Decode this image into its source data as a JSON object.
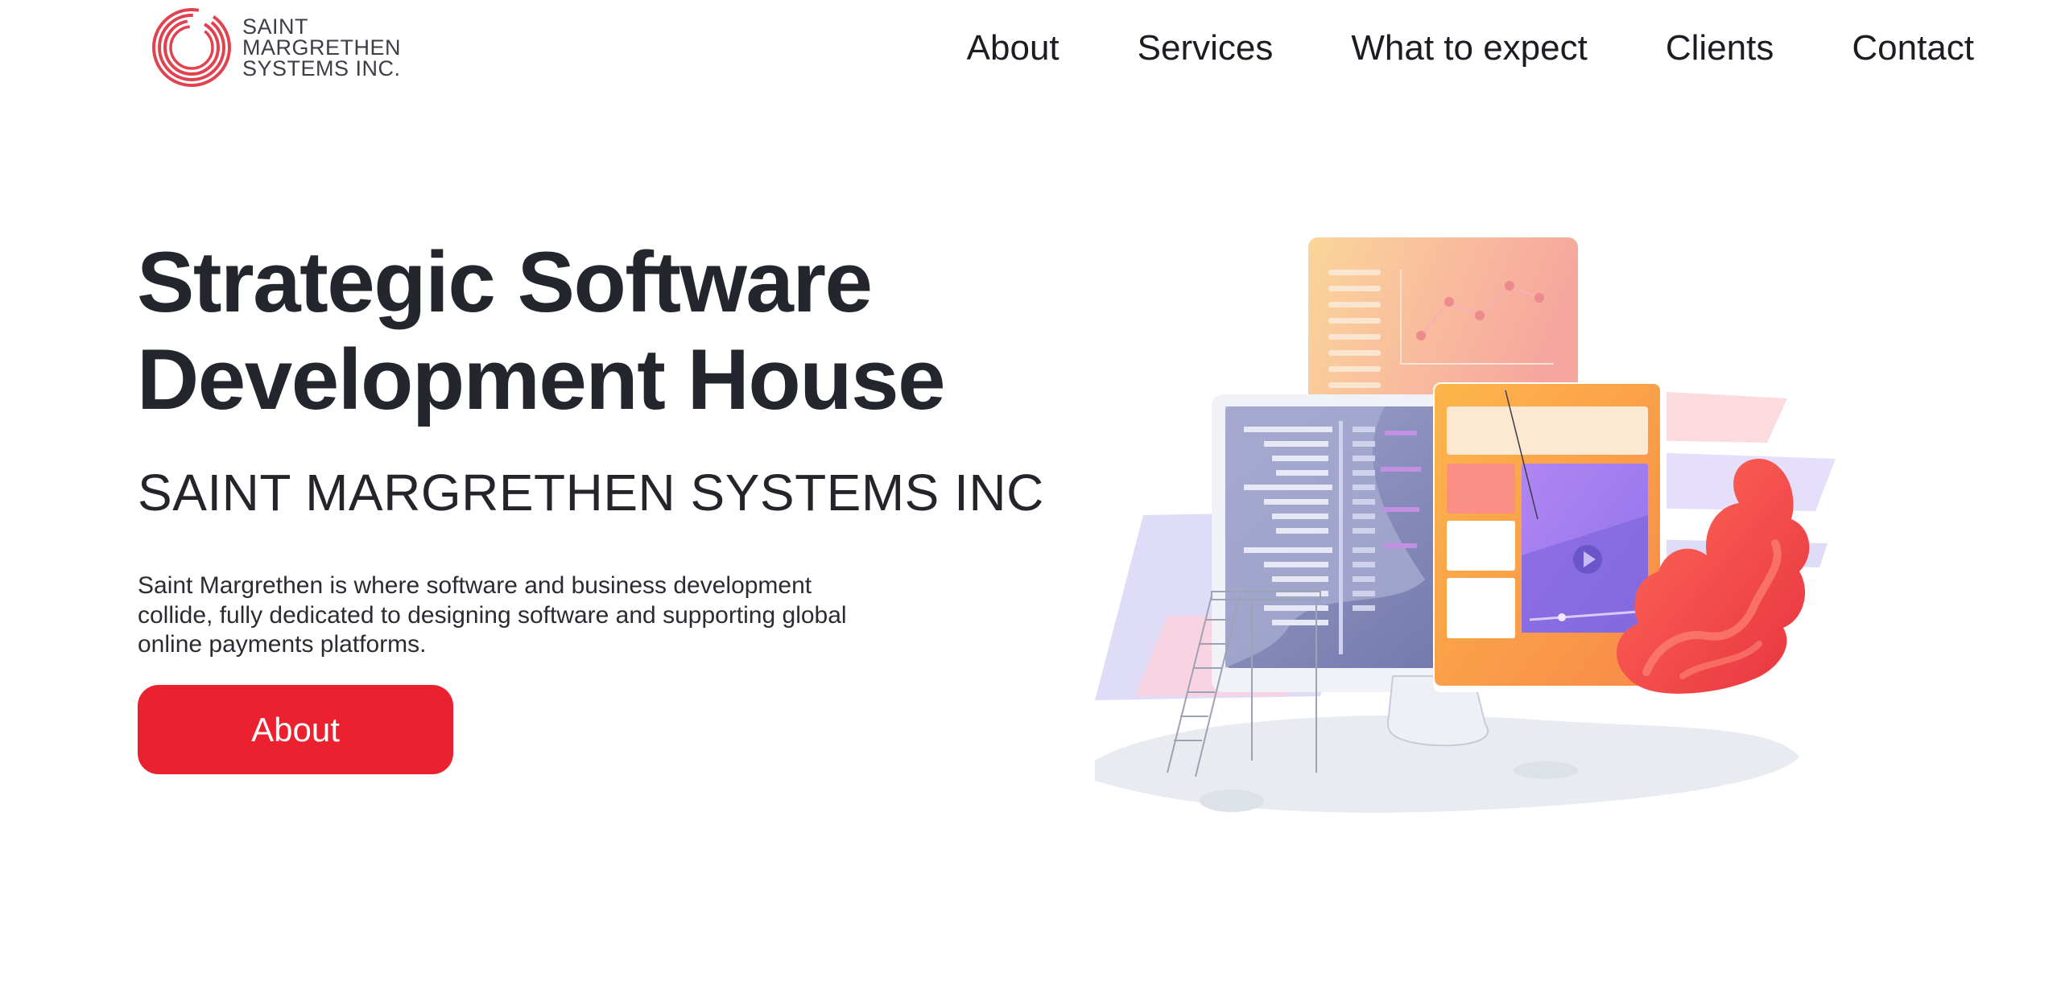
{
  "brand": {
    "logo_line1": "SAINT",
    "logo_line2": "MARGRETHEN",
    "logo_line3": "SYSTEMS INC.",
    "accent_color": "#ec212f"
  },
  "nav": {
    "items": [
      {
        "label": "About"
      },
      {
        "label": "Services"
      },
      {
        "label": "What to expect"
      },
      {
        "label": "Clients"
      },
      {
        "label": "Contact"
      }
    ]
  },
  "hero": {
    "title": "Strategic Software Development House",
    "subtitle": "SAINT MARGRETHEN SYSTEMS INC",
    "description": "Saint Margrethen is where software and business development collide, fully dedicated to designing software and supporting global online payments platforms.",
    "cta_label": "About"
  },
  "illustration": {
    "icon": "computer-dashboard-illustration",
    "play_icon": "play-icon"
  }
}
